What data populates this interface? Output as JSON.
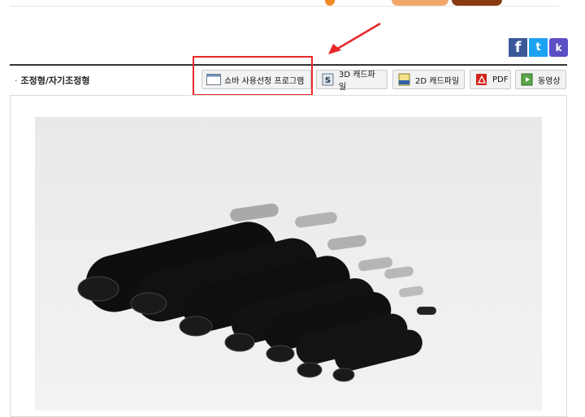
{
  "social": {
    "facebook_glyph": "f",
    "twitter_glyph": "t",
    "kakaostory_glyph": "k"
  },
  "section": {
    "bullet": "·",
    "title": "조정형/자기조정형"
  },
  "toolbar": {
    "selection_program": "쇼바 사용선정 프로그램",
    "cad_3d": "3D 캐드파일",
    "cad_2d": "2D 캐드파일",
    "pdf": "PDF",
    "video": "동영상"
  },
  "colors": {
    "highlight": "#e8282a",
    "arrow": "#e8282a",
    "facebook": "#3b5998",
    "twitter": "#1da1f2",
    "kakaostory": "#5b4fc4"
  },
  "product_photo": {
    "subject": "shock-absorbers"
  }
}
